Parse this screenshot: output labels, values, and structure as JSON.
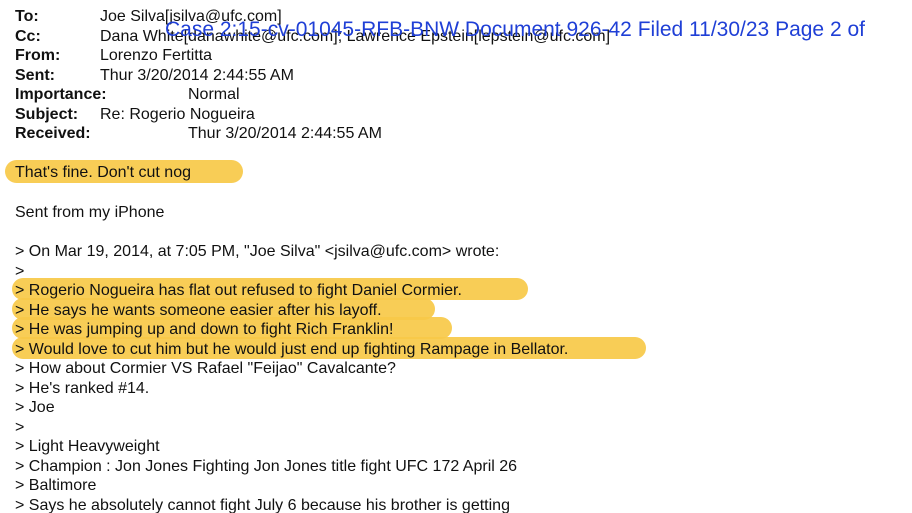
{
  "header": {
    "to_label": "To:",
    "to_value": "Joe Silva[jsilva@ufc.com]",
    "cc_label": "Cc:",
    "cc_value": "Dana White[danawhite@ufc.com]; Lawrence Epstein[lepstein@ufc.com]",
    "from_label": "From:",
    "from_value": "Lorenzo Fertitta",
    "sent_label": "Sent:",
    "sent_value": "Thur 3/20/2014 2:44:55 AM",
    "importance_label": "Importance:",
    "importance_value": "Normal",
    "subject_label": "Subject:",
    "subject_value": "Re: Rogerio Nogueira",
    "received_label": "Received:",
    "received_value": "Thur 3/20/2014 2:44:55 AM"
  },
  "court_stamp": "Case 2:15-cv-01045-RFB-BNW   Document 926-42   Filed 11/30/23   Page 2 of",
  "body": {
    "reply": "That's fine.  Don't cut nog",
    "signature": "Sent from my iPhone",
    "quoted": [
      "> On Mar 19, 2014, at 7:05 PM, \"Joe Silva\" <jsilva@ufc.com> wrote:",
      ">",
      "> Rogerio Nogueira has flat out refused to fight Daniel Cormier.",
      "> He says he wants someone easier after his layoff.",
      "> He was jumping up and down to fight Rich Franklin!",
      "> Would love to cut him but he would just end up fighting Rampage in Bellator.",
      "> How about Cormier VS Rafael \"Feijao\" Cavalcante?",
      "> He's ranked #14.",
      "> Joe",
      ">",
      "> Light Heavyweight",
      "> Champion : Jon Jones Fighting Jon Jones title fight UFC 172 April 26",
      "> Baltimore",
      "> Says he absolutely cannot fight July 6 because his brother is getting"
    ]
  },
  "colors": {
    "highlight": "#f7c948",
    "stamp": "#1f3fd6",
    "text": "#111111"
  }
}
